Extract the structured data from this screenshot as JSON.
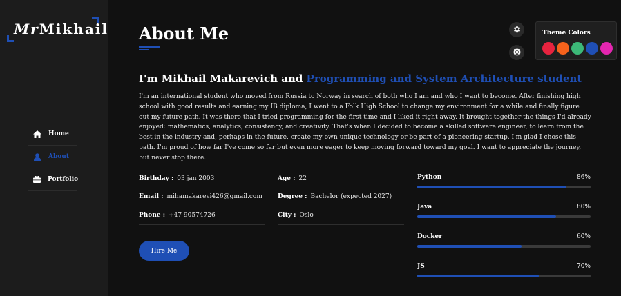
{
  "logo": {
    "prefix": "Mr",
    "name": "Mikhail"
  },
  "nav": [
    {
      "label": "Home",
      "icon": "home-icon",
      "active": false
    },
    {
      "label": "About",
      "icon": "user-icon",
      "active": true
    },
    {
      "label": "Portfolio",
      "icon": "briefcase-icon",
      "active": false
    }
  ],
  "page": {
    "title": "About Me"
  },
  "intro": {
    "lead": "I'm Mikhail Makarevich and ",
    "role": "Programming and System Architecture student"
  },
  "bio": "I'm an international student who moved from Russia to Norway in search of both who I am and who I want to become. After finishing high school with good results and earning my IB diploma, I went to a Folk High School to change my environment for a while and finally figure out my future path. It was there that I tried programming for the first time and I liked it right away. It brought together the things I'd already enjoyed: mathematics, analytics, consistency, and creativity. That's when I decided to become a skilled software engineer, to learn from the best in the industry and, perhaps in the future, create my own unique technology or be part of a pioneering startup. I'm glad I chose this path. I'm proud of how far I've come so far but even more eager to keep moving forward toward my goal. I want to appreciate the journey, but never stop there.",
  "info_left": [
    {
      "key": "Birthday :",
      "value": "03 jan 2003"
    },
    {
      "key": "Email :",
      "value": "mihamakarevi426@gmail.com"
    },
    {
      "key": "Phone :",
      "value": "+47 90574726"
    }
  ],
  "info_right": [
    {
      "key": "Age :",
      "value": "22"
    },
    {
      "key": "Degree :",
      "value": "Bachelor (expected 2027)"
    },
    {
      "key": "City :",
      "value": "Oslo"
    }
  ],
  "hire_button": "Hire Me",
  "skills": [
    {
      "name": "Python",
      "percent_label": "86%",
      "percent": 86
    },
    {
      "name": "Java",
      "percent_label": "80%",
      "percent": 80
    },
    {
      "name": "Docker",
      "percent_label": "60%",
      "percent": 60
    },
    {
      "name": "JS",
      "percent_label": "70%",
      "percent": 70
    }
  ],
  "theme": {
    "title": "Theme Colors",
    "colors": [
      "#e8233f",
      "#f5621c",
      "#3cb878",
      "#1f4fb5",
      "#e426b0"
    ]
  },
  "accent_color": "#1f4fb5"
}
